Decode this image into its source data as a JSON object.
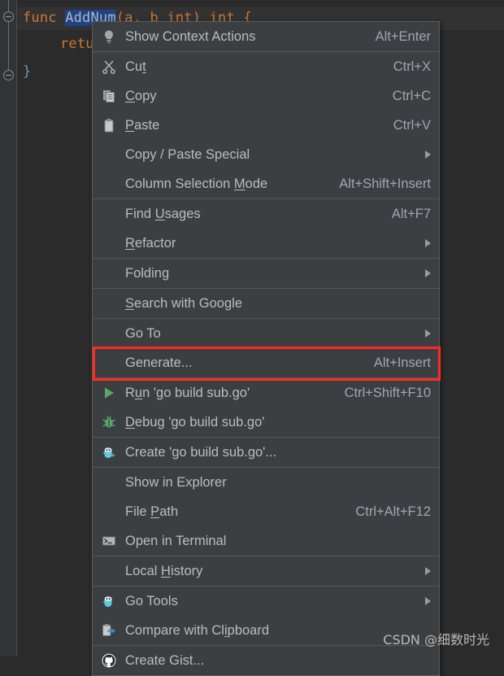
{
  "editor": {
    "line1": {
      "kw_func": "func",
      "selected_name": "AddNum",
      "params": "(a, b int) int {"
    },
    "line2": "return",
    "line3": "}"
  },
  "context_menu": {
    "groups": [
      {
        "items": [
          {
            "icon": "lightbulb-icon",
            "label": "Show Context Actions",
            "shortcut": "Alt+Enter",
            "arrow": false
          }
        ]
      },
      {
        "items": [
          {
            "icon": "scissors-icon",
            "label": "Cut",
            "shortcut": "Ctrl+X",
            "arrow": false
          },
          {
            "icon": "copy-icon",
            "label": "Copy",
            "shortcut": "Ctrl+C",
            "arrow": false
          },
          {
            "icon": "clipboard-icon",
            "label": "Paste",
            "shortcut": "Ctrl+V",
            "arrow": false
          },
          {
            "icon": "",
            "label": "Copy / Paste Special",
            "shortcut": "",
            "arrow": true
          },
          {
            "icon": "",
            "label": "Column Selection Mode",
            "shortcut": "Alt+Shift+Insert",
            "arrow": false
          }
        ]
      },
      {
        "items": [
          {
            "icon": "",
            "label": "Find Usages",
            "shortcut": "Alt+F7",
            "arrow": false
          },
          {
            "icon": "",
            "label": "Refactor",
            "shortcut": "",
            "arrow": true
          }
        ]
      },
      {
        "items": [
          {
            "icon": "",
            "label": "Folding",
            "shortcut": "",
            "arrow": true
          }
        ]
      },
      {
        "items": [
          {
            "icon": "",
            "label": "Search with Google",
            "shortcut": "",
            "arrow": false
          }
        ]
      },
      {
        "items": [
          {
            "icon": "",
            "label": "Go To",
            "shortcut": "",
            "arrow": true
          },
          {
            "icon": "",
            "label": "Generate...",
            "shortcut": "Alt+Insert",
            "arrow": false
          }
        ]
      },
      {
        "items": [
          {
            "icon": "run-icon",
            "label": "Run 'go build sub.go'",
            "shortcut": "Ctrl+Shift+F10",
            "arrow": false
          },
          {
            "icon": "debug-icon",
            "label": "Debug 'go build sub.go'",
            "shortcut": "",
            "arrow": false
          }
        ]
      },
      {
        "items": [
          {
            "icon": "go-gopher-run-icon",
            "label": "Create 'go build sub.go'...",
            "shortcut": "",
            "arrow": false
          }
        ]
      },
      {
        "items": [
          {
            "icon": "",
            "label": "Show in Explorer",
            "shortcut": "",
            "arrow": false
          },
          {
            "icon": "",
            "label": "File Path",
            "shortcut": "Ctrl+Alt+F12",
            "arrow": false
          },
          {
            "icon": "terminal-icon",
            "label": "Open in Terminal",
            "shortcut": "",
            "arrow": false
          }
        ]
      },
      {
        "items": [
          {
            "icon": "",
            "label": "Local History",
            "shortcut": "",
            "arrow": true
          }
        ]
      },
      {
        "items": [
          {
            "icon": "go-gopher-icon",
            "label": "Go Tools",
            "shortcut": "",
            "arrow": true
          },
          {
            "icon": "compare-clipboard-icon",
            "label": "Compare with Clipboard",
            "shortcut": "",
            "arrow": false
          }
        ]
      },
      {
        "items": [
          {
            "icon": "github-icon",
            "label": "Create Gist...",
            "shortcut": "",
            "arrow": false
          }
        ]
      }
    ]
  },
  "annotation": {
    "target_label": "Generate...",
    "box_color": "#ff2a20"
  },
  "watermark": "CSDN @细数时光",
  "colors": {
    "editor_bg": "#2b2b2b",
    "menu_bg": "#3c3f41",
    "menu_text": "#bbbbbb",
    "selection_bg": "#214283",
    "keyword": "#cc7832",
    "accent_red": "#ff2a20"
  }
}
